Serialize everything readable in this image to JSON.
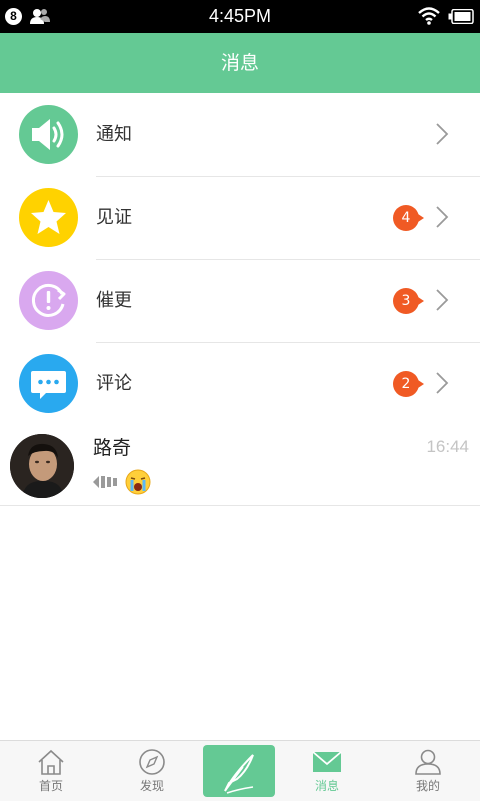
{
  "status_bar": {
    "notification_count": "8",
    "time": "4:45PM"
  },
  "header": {
    "title": "消息"
  },
  "categories": [
    {
      "label": "通知",
      "icon": "speaker-icon",
      "color": "#64c994",
      "badge": ""
    },
    {
      "label": "见证",
      "icon": "star-icon",
      "color": "#ffd200",
      "badge": "4"
    },
    {
      "label": "催更",
      "icon": "reminder-icon",
      "color": "#d9a8ef",
      "badge": "3"
    },
    {
      "label": "评论",
      "icon": "comment-icon",
      "color": "#29a9ef",
      "badge": "2"
    }
  ],
  "conversation": {
    "name": "路奇",
    "time": "16:44",
    "preview_icons": [
      "voice-message-icon",
      "crying-emoji-icon"
    ]
  },
  "tabbar": {
    "tabs": [
      {
        "label": "首页",
        "icon": "home-icon"
      },
      {
        "label": "发现",
        "icon": "compass-icon"
      },
      {
        "label": "",
        "icon": "feather-quill-icon"
      },
      {
        "label": "消息",
        "icon": "mail-icon"
      },
      {
        "label": "我的",
        "icon": "person-icon"
      }
    ],
    "active_tab": "消息",
    "accent_color": "#64c994"
  }
}
